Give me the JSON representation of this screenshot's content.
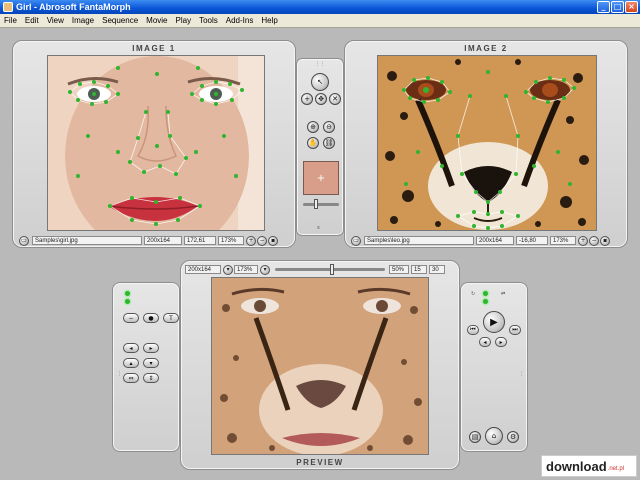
{
  "window": {
    "title": "Girl - Abrosoft FantaMorph",
    "min": "_",
    "max": "□",
    "close": "×"
  },
  "menu": [
    "File",
    "Edit",
    "View",
    "Image",
    "Sequence",
    "Movie",
    "Play",
    "Tools",
    "Add-Ins",
    "Help"
  ],
  "image1": {
    "title": "IMAGE 1",
    "path": "Samples\\girl.jpg",
    "size": "200x164",
    "coord": "172,61",
    "zoom": "173%"
  },
  "image2": {
    "title": "IMAGE 2",
    "path": "Samples\\leo.jpg",
    "size": "200x164",
    "coord": "-16,80",
    "zoom": "173%"
  },
  "preview": {
    "title": "PREVIEW",
    "size": "200x164",
    "zoom": "173%",
    "percent": "50%",
    "frame": "15",
    "frames": "30"
  },
  "watermark": {
    "text": "download",
    "suffix": ".net.pl"
  },
  "colors": {
    "titlebar": "#0a55d8",
    "panel": "#d8d8d8",
    "keypoint": "#2fb52f",
    "workspace": "#b9b9b9"
  }
}
